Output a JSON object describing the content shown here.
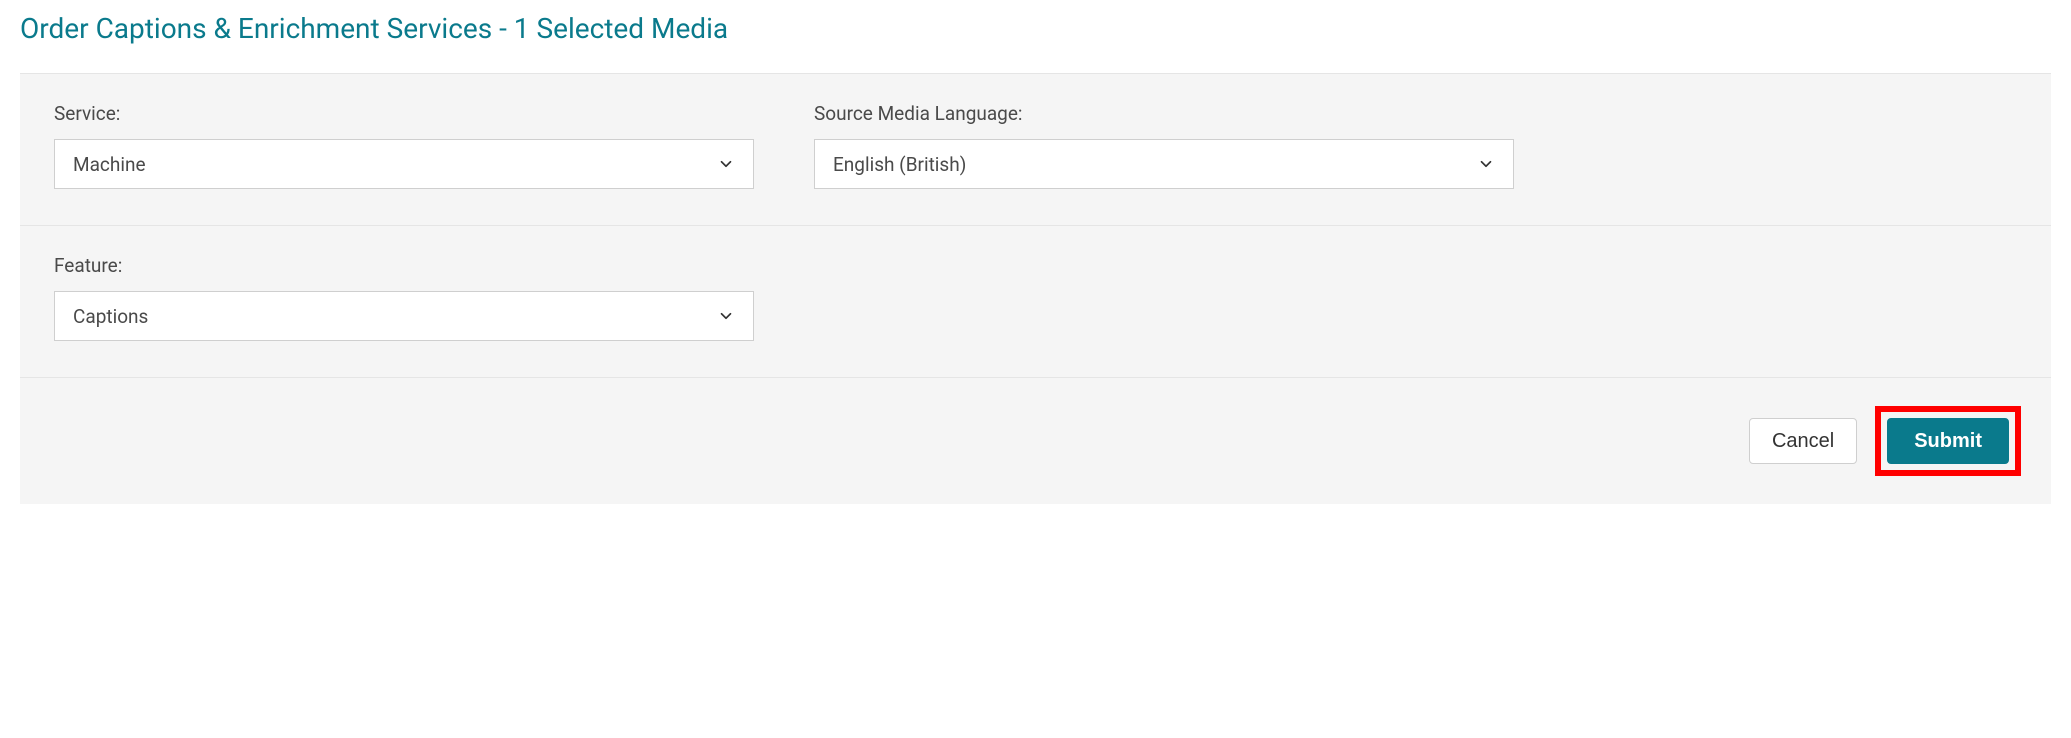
{
  "title": "Order Captions & Enrichment Services - 1 Selected Media",
  "fields": {
    "service": {
      "label": "Service:",
      "value": "Machine"
    },
    "source_language": {
      "label": "Source Media Language:",
      "value": "English (British)"
    },
    "feature": {
      "label": "Feature:",
      "value": "Captions"
    }
  },
  "actions": {
    "cancel": "Cancel",
    "submit": "Submit"
  }
}
